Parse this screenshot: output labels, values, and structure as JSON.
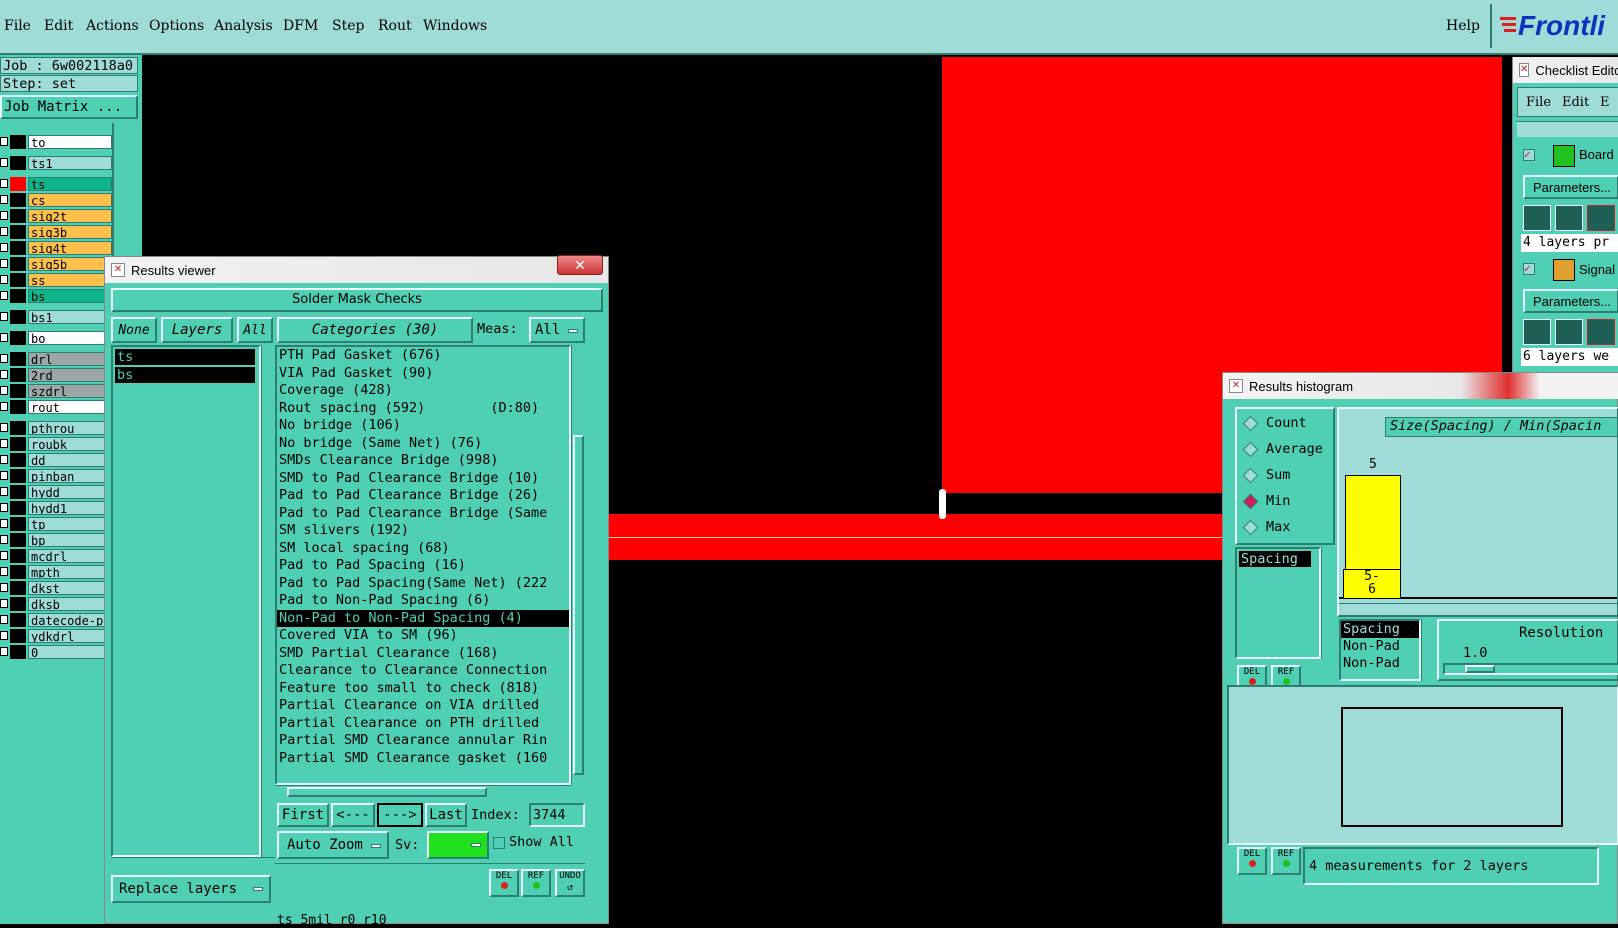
{
  "menubar": {
    "items": [
      "File",
      "Edit",
      "Actions",
      "Options",
      "Analysis",
      "DFM",
      "Step",
      "Rout",
      "Windows"
    ],
    "help": "Help",
    "logo_text": "Frontli"
  },
  "job": {
    "job_label": "Job : 6w002118a0",
    "step_label": "Step: set",
    "matrix_button": "Job Matrix ..."
  },
  "layers": [
    {
      "name": "to",
      "color": "#ffffff"
    },
    {
      "name": "ts1",
      "color": "#9fdcd8"
    },
    {
      "name": "ts",
      "color": "#0fb68a",
      "active": true
    },
    {
      "name": "cs",
      "color": "#ffc04c"
    },
    {
      "name": "sig2t",
      "color": "#ffc04c"
    },
    {
      "name": "sig3b",
      "color": "#ffc04c"
    },
    {
      "name": "sig4t",
      "color": "#ffc04c"
    },
    {
      "name": "sig5b",
      "color": "#ffc04c"
    },
    {
      "name": "ss",
      "color": "#ffc04c"
    },
    {
      "name": "bs",
      "color": "#0fb68a"
    },
    {
      "name": "bs1",
      "color": "#9fdcd8"
    },
    {
      "name": "bo",
      "color": "#ffffff"
    },
    {
      "name": "drl",
      "color": "#9fa6a6"
    },
    {
      "name": "2rd",
      "color": "#9fa6a6"
    },
    {
      "name": "szdrl",
      "color": "#9fa6a6"
    },
    {
      "name": "rout",
      "color": "#ffffff"
    },
    {
      "name": "pthrou",
      "color": "#9fdcd8"
    },
    {
      "name": "roubk",
      "color": "#9fdcd8"
    },
    {
      "name": "dd",
      "color": "#9fdcd8"
    },
    {
      "name": "pinban",
      "color": "#9fdcd8"
    },
    {
      "name": "hydd",
      "color": "#9fdcd8"
    },
    {
      "name": "hydd1",
      "color": "#9fdcd8"
    },
    {
      "name": "tp",
      "color": "#9fdcd8"
    },
    {
      "name": "bp",
      "color": "#9fdcd8"
    },
    {
      "name": "mcdrl",
      "color": "#9fdcd8"
    },
    {
      "name": "mpth",
      "color": "#9fdcd8"
    },
    {
      "name": "dkst",
      "color": "#9fdcd8"
    },
    {
      "name": "dksb",
      "color": "#9fdcd8"
    },
    {
      "name": "datecode-pl",
      "color": "#9fdcd8"
    },
    {
      "name": "ydkdrl",
      "color": "#9fdcd8"
    },
    {
      "name": "0",
      "color": "#9fdcd8"
    }
  ],
  "results_viewer": {
    "title": "Results viewer",
    "header": "Solder Mask Checks",
    "none_btn": "None",
    "layers_btn": "Layers",
    "all_btn": "All",
    "categories_btn": "Categories (30)",
    "meas_label": "Meas:",
    "meas_value": "All",
    "layer_list": [
      "ts",
      "bs"
    ],
    "categories": [
      "PTH Pad Gasket (676)",
      "VIA Pad Gasket (90)",
      "Coverage (428)",
      "Rout spacing (592)        (D:80)",
      "No bridge (106)",
      "No bridge (Same Net) (76)",
      "SMDs Clearance Bridge (998)",
      "SMD to Pad Clearance Bridge (10)",
      "Pad to Pad Clearance Bridge (26)",
      "Pad to Pad Clearance Bridge (Same",
      "SM slivers (192)",
      "SM local spacing (68)",
      "Pad to Pad Spacing (16)",
      "Pad to Pad Spacing(Same Net) (222",
      "Pad to Non-Pad Spacing (6)",
      "Non-Pad to Non-Pad Spacing (4)",
      "Covered VIA to SM (96)",
      "SMD Partial Clearance (168)",
      "Clearance to Clearance Connection",
      "Feature too small to check (818)",
      "Partial Clearance on VIA drilled",
      "Partial Clearance on PTH drilled",
      "Partial SMD Clearance annular Rin",
      "Partial SMD Clearance gasket (160"
    ],
    "selected_index": 15,
    "first_btn": "First",
    "prev_btn": "<---",
    "next_btn": "--->",
    "last_btn": "Last",
    "index_label": "Index:",
    "index_value": "3744",
    "autozoom_btn": "Auto Zoom",
    "sv_label": "Sv:",
    "show_all_label": "Show All",
    "replace_btn": "Replace layers",
    "del_label": "DEL",
    "ref_label": "REF",
    "undo_label": "UNDO",
    "status_text": "ts 5mil r0 r10"
  },
  "checklist_editor": {
    "title": "Checklist Edito",
    "menu": [
      "File",
      "Edit",
      "E"
    ],
    "item1": "Board",
    "params_btn": "Parameters...",
    "layers_text1": "4 layers pr",
    "item2": "Signal",
    "layers_text2": "6 layers we"
  },
  "histogram": {
    "title": "Results histogram",
    "options": [
      "Count",
      "Average",
      "Sum",
      "Min",
      "Max"
    ],
    "selected_option": "Min",
    "list_items": [
      "Spacing"
    ],
    "chart_title": "Size(Spacing) / Min(Spacin",
    "bar_value_label": "5",
    "bar_category": "5-\n6",
    "meas_list": [
      "Spacing",
      "Non-Pad",
      "Non-Pad"
    ],
    "resolution_label": "Resolution",
    "resolution_value": "1.0",
    "status_text": "4 measurements for 2 layers",
    "del_label": "DEL",
    "ref_label": "REF"
  }
}
